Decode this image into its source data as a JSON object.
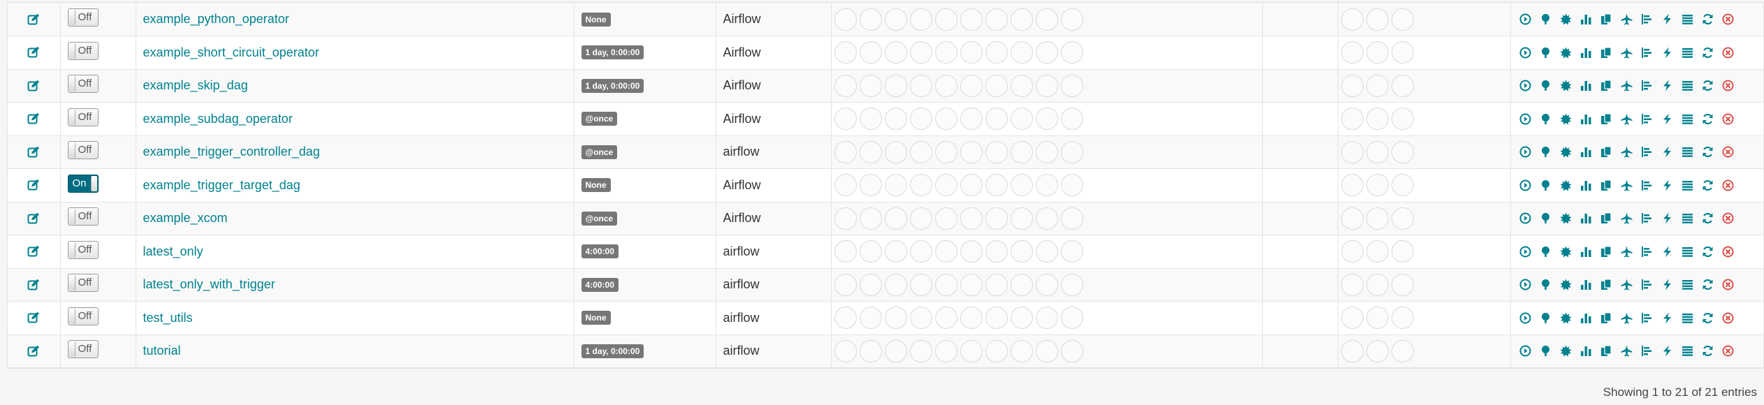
{
  "rows": [
    {
      "name": "example_python_operator",
      "toggle": "Off",
      "schedule": "None",
      "owner": "Airflow"
    },
    {
      "name": "example_short_circuit_operator",
      "toggle": "Off",
      "schedule": "1 day, 0:00:00",
      "owner": "Airflow"
    },
    {
      "name": "example_skip_dag",
      "toggle": "Off",
      "schedule": "1 day, 0:00:00",
      "owner": "Airflow"
    },
    {
      "name": "example_subdag_operator",
      "toggle": "Off",
      "schedule": "@once",
      "owner": "Airflow"
    },
    {
      "name": "example_trigger_controller_dag",
      "toggle": "Off",
      "schedule": "@once",
      "owner": "airflow"
    },
    {
      "name": "example_trigger_target_dag",
      "toggle": "On",
      "schedule": "None",
      "owner": "Airflow"
    },
    {
      "name": "example_xcom",
      "toggle": "Off",
      "schedule": "@once",
      "owner": "Airflow"
    },
    {
      "name": "latest_only",
      "toggle": "Off",
      "schedule": "4:00:00",
      "owner": "airflow"
    },
    {
      "name": "latest_only_with_trigger",
      "toggle": "Off",
      "schedule": "4:00:00",
      "owner": "airflow"
    },
    {
      "name": "test_utils",
      "toggle": "Off",
      "schedule": "None",
      "owner": "airflow"
    },
    {
      "name": "tutorial",
      "toggle": "Off",
      "schedule": "1 day, 0:00:00",
      "owner": "airflow"
    }
  ],
  "recent_task_circles": 10,
  "dag_run_circles": 3,
  "link_icons": [
    "trigger-dag-icon",
    "tree-view-icon",
    "graph-view-icon",
    "task-duration-icon",
    "task-tries-icon",
    "landing-times-icon",
    "gantt-icon",
    "code-view-icon",
    "logs-icon",
    "refresh-icon",
    "delete-dag-icon"
  ],
  "colors": {
    "accent": "#00818f",
    "badge": "#777777",
    "delete": "#d9534f",
    "toggle_on": "#006c80"
  },
  "footer": {
    "entries_text": "Showing 1 to 21 of 21 entries"
  }
}
